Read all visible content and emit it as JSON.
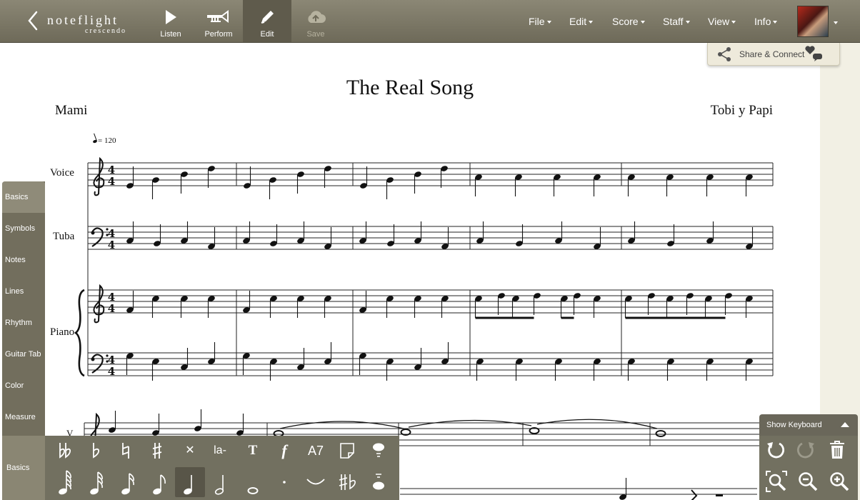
{
  "app": {
    "logo_main": "noteflight",
    "logo_sub": "crescendo"
  },
  "toolbar": {
    "listen": "Listen",
    "perform": "Perform",
    "edit": "Edit",
    "save": "Save"
  },
  "menus": {
    "file": "File",
    "edit": "Edit",
    "score": "Score",
    "staff": "Staff",
    "view": "View",
    "info": "Info"
  },
  "share": {
    "label": "Share & Connect"
  },
  "score": {
    "title": "The Real Song",
    "lyricist": "Mami",
    "composer": "Tobi y Papi",
    "tempo": "= 120",
    "staves": [
      "Voice",
      "Tuba",
      "Piano"
    ],
    "next_system_label": "V",
    "time_signature": "4/4"
  },
  "left_tabs": [
    "Basics",
    "Symbols",
    "Notes",
    "Lines",
    "Rhythm",
    "Guitar Tab",
    "Color",
    "Measure"
  ],
  "left_tab_active": "Basics",
  "bottom_palette": {
    "label": "Basics",
    "text_labels": {
      "lyric": "la-",
      "text": "T",
      "dynamic": "f",
      "chord": "A7"
    }
  },
  "right_panel": {
    "show_keyboard": "Show Keyboard"
  },
  "colors": {
    "toolbar": "#7d7967",
    "panel": "#727060",
    "paper": "#ffffff",
    "background": "#f2f0e4",
    "logo_accent": "#e07b39"
  }
}
